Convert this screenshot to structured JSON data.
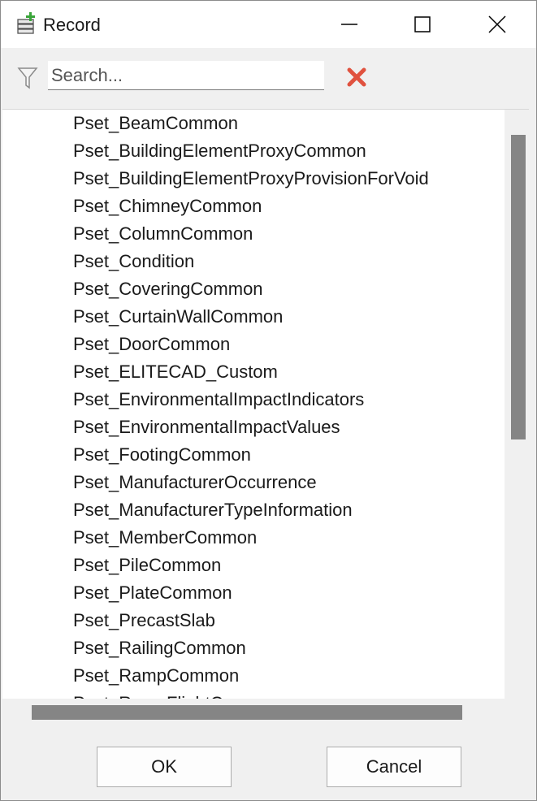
{
  "window": {
    "title": "Record"
  },
  "icons": {
    "app": "record-add-icon",
    "filter": "filter-icon",
    "clear": "clear-search-icon",
    "minimize": "minimize-icon",
    "maximize": "maximize-icon",
    "close": "close-icon"
  },
  "colors": {
    "clear_icon": "#e0523f",
    "scrollbar_thumb": "#858585"
  },
  "search": {
    "placeholder": "Search...",
    "value": ""
  },
  "list": {
    "items": [
      "Pset_BeamCommon",
      "Pset_BuildingElementProxyCommon",
      "Pset_BuildingElementProxyProvisionForVoid",
      "Pset_ChimneyCommon",
      "Pset_ColumnCommon",
      "Pset_Condition",
      "Pset_CoveringCommon",
      "Pset_CurtainWallCommon",
      "Pset_DoorCommon",
      "Pset_ELITECAD_Custom",
      "Pset_EnvironmentalImpactIndicators",
      "Pset_EnvironmentalImpactValues",
      "Pset_FootingCommon",
      "Pset_ManufacturerOccurrence",
      "Pset_ManufacturerTypeInformation",
      "Pset_MemberCommon",
      "Pset_PileCommon",
      "Pset_PlateCommon",
      "Pset_PrecastSlab",
      "Pset_RailingCommon",
      "Pset_RampCommon",
      "Pset_RampFlightC"
    ]
  },
  "buttons": {
    "ok": "OK",
    "cancel": "Cancel"
  }
}
